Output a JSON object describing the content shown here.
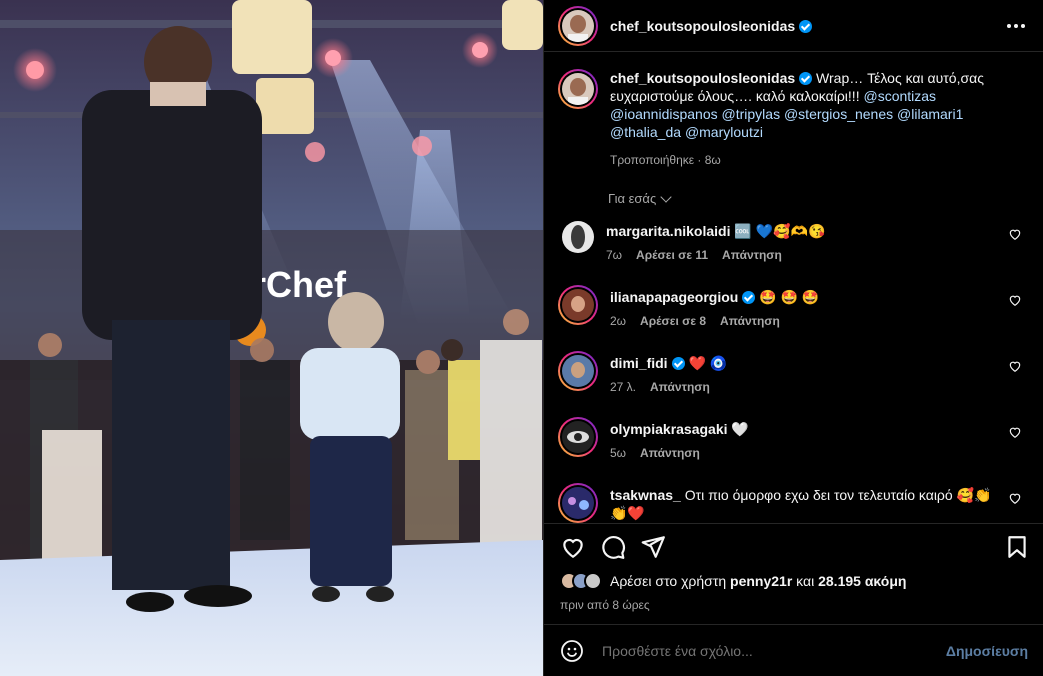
{
  "post": {
    "username": "chef_koutsopoulosleonidas",
    "caption_text": "Wrap… Τέλος και αυτό,σας ευχαριστούμε όλους…. καλό καλοκαίρι!!! ",
    "mentions": [
      "@scontizas",
      "@ioannidispanos",
      "@tripylas",
      "@stergios_nenes",
      "@lilamari1",
      "@thalia_da",
      "@maryloutzi"
    ],
    "edited": "Τροποποιήθηκε · 8ω",
    "for_you": "Για εσάς",
    "photo_sign_text": "erChef"
  },
  "comments": [
    {
      "user": "margarita.nikolaidi",
      "verified": false,
      "text": "🆒 💙🥰🫶😘",
      "time": "7ω",
      "likes": "Αρέσει σε 11",
      "reply": "Απάντηση"
    },
    {
      "user": "ilianapapageorgiou",
      "verified": true,
      "text": "🤩 🤩 🤩",
      "time": "2ω",
      "likes": "Αρέσει σε 8",
      "reply": "Απάντηση"
    },
    {
      "user": "dimi_fidi",
      "verified": true,
      "text": "❤️ 🧿",
      "time": "27 λ.",
      "likes": "",
      "reply": "Απάντηση"
    },
    {
      "user": "olympiakrasagaki",
      "verified": false,
      "text": "🤍",
      "time": "5ω",
      "likes": "",
      "reply": "Απάντηση"
    },
    {
      "user": "tsakwnas_",
      "verified": false,
      "text": "Οτι πιο όμορφο εχω δει τον τελευταίο καιρό 🥰👏👏❤️",
      "time": "",
      "likes": "",
      "reply": ""
    }
  ],
  "likes": {
    "prefix": "Αρέσει στο χρήστη",
    "user": "penny21r",
    "middle": "και",
    "count": "28.195 ακόμη"
  },
  "time_ago": "πριν από 8 ώρες",
  "add_comment": {
    "placeholder": "Προσθέστε ένα σχόλιο...",
    "publish": "Δημοσίευση"
  },
  "colors": {
    "verified": "#0095f6",
    "story_ring": "#ee2a7b",
    "secondary_text": "#a8a8a8",
    "mention": "#b3dbff"
  }
}
